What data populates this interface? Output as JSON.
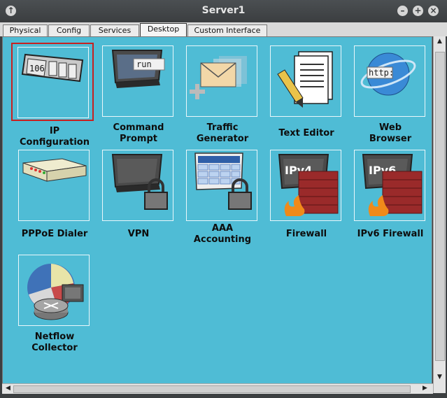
{
  "window": {
    "title": "Server1"
  },
  "tabs": [
    {
      "label": "Physical"
    },
    {
      "label": "Config"
    },
    {
      "label": "Services"
    },
    {
      "label": "Desktop"
    },
    {
      "label": "Custom Interface"
    }
  ],
  "active_tab": "Desktop",
  "apps": [
    {
      "label1": "IP",
      "label2": "Configuration",
      "icon": "ip-configuration-icon",
      "icon_text": "106",
      "selected": true
    },
    {
      "label1": "Command",
      "label2": "Prompt",
      "icon": "command-prompt-icon",
      "icon_text": "run"
    },
    {
      "label1": "Traffic",
      "label2": "Generator",
      "icon": "traffic-generator-icon"
    },
    {
      "label1": "Text Editor",
      "label2": "",
      "icon": "text-editor-icon"
    },
    {
      "label1": "Web",
      "label2": "Browser",
      "icon": "web-browser-icon",
      "icon_text": "http:"
    },
    {
      "label1": "PPPoE Dialer",
      "label2": "",
      "icon": "pppoe-dialer-icon"
    },
    {
      "label1": "VPN",
      "label2": "",
      "icon": "vpn-icon"
    },
    {
      "label1": "AAA",
      "label2": "Accounting",
      "icon": "aaa-accounting-icon"
    },
    {
      "label1": "Firewall",
      "label2": "",
      "icon": "firewall-icon",
      "icon_text": "IPv4"
    },
    {
      "label1": "IPv6 Firewall",
      "label2": "",
      "icon": "ipv6-firewall-icon",
      "icon_text": "IPv6"
    },
    {
      "label1": "Netflow",
      "label2": "Collector",
      "icon": "netflow-collector-icon"
    }
  ]
}
